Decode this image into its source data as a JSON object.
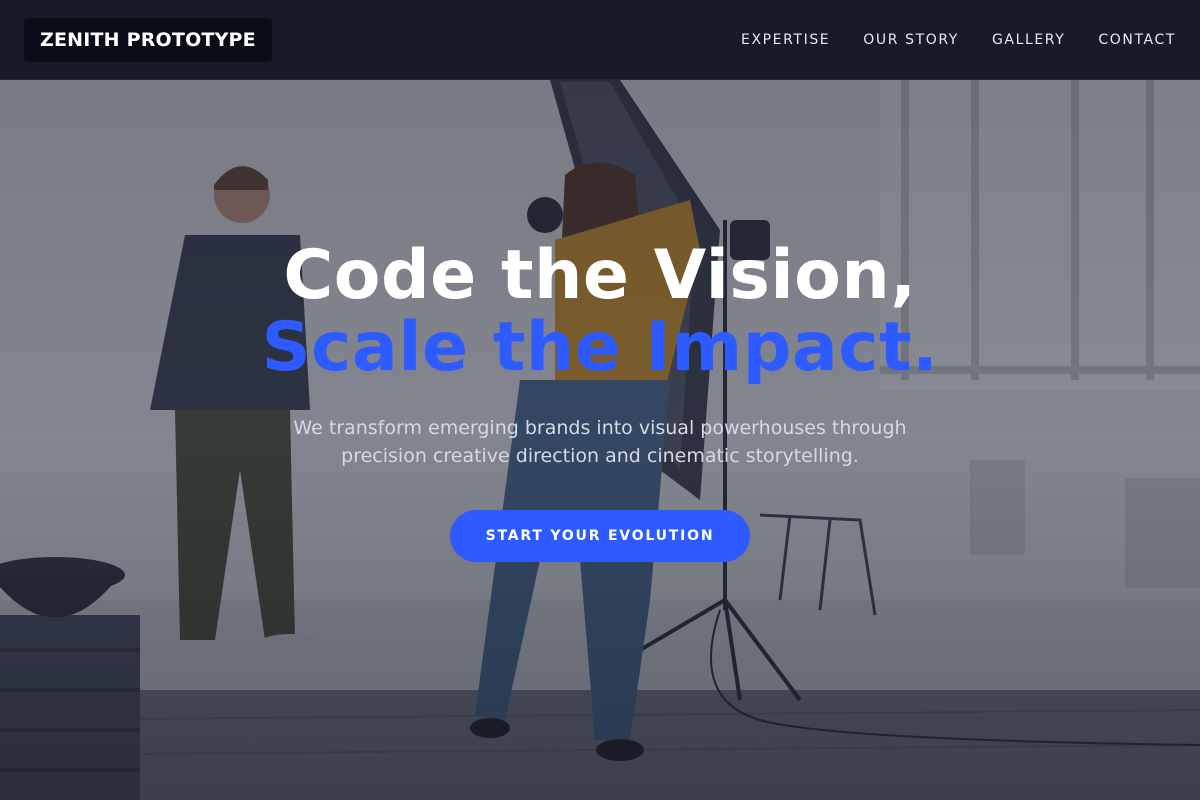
{
  "header": {
    "logo_text": "ZENITH PROTOTYPE",
    "nav": [
      {
        "label": "EXPERTISE"
      },
      {
        "label": "OUR STORY"
      },
      {
        "label": "GALLERY"
      },
      {
        "label": "CONTACT"
      }
    ]
  },
  "hero": {
    "headline_line1": "Code the Vision,",
    "headline_line2": "Scale the Impact.",
    "subtext": "We transform emerging brands into visual powerhouses through precision creative direction and cinematic storytelling.",
    "cta_label": "START YOUR EVOLUTION"
  },
  "colors": {
    "accent": "#2e5bff",
    "header_bg": "#141624",
    "logo_bg": "#0a0c18",
    "headline_white": "#ffffff"
  }
}
